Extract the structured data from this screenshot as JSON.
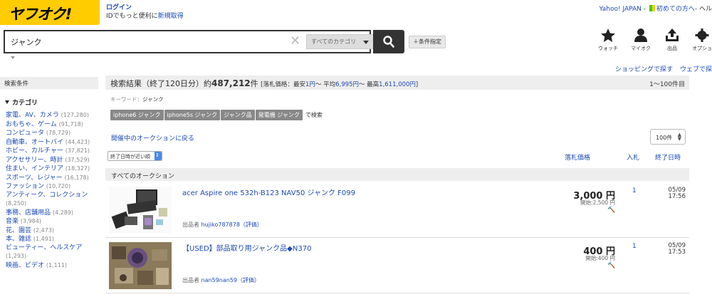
{
  "header": {
    "logo_text": "ヤフオク!",
    "login_label": "ログイン",
    "login_sub_prefix": "IDでもっと便利に",
    "register_link": "新規取得",
    "yahoo_japan": "Yahoo! JAPAN",
    "dash": " - ",
    "first_time": "初めての方へ",
    "help_cut": "- ヘル"
  },
  "search": {
    "query": "ジャンク",
    "category_label": "すべてのカテゴリ",
    "conditions_button": "＋条件指定"
  },
  "toolbar": {
    "watch": "ウォッチ",
    "myauc": "マイオク",
    "sell": "出品",
    "options": "オプショ"
  },
  "sublinks": {
    "shopping": "ショッピングで探す",
    "web": "ウェブで探"
  },
  "sidebar": {
    "heading": "検索条件",
    "category_heading": "カテゴリ",
    "items": [
      {
        "label": "家電、AV、カメラ",
        "count": "(127,280)"
      },
      {
        "label": "おもちゃ、ゲーム",
        "count": "(91,718)"
      },
      {
        "label": "コンピュータ",
        "count": "(78,729)"
      },
      {
        "label": "自動車、オートバイ",
        "count": "(44,423)"
      },
      {
        "label": "ホビー、カルチャー",
        "count": "(37,821)"
      },
      {
        "label": "アクセサリー、時計",
        "count": "(37,529)"
      },
      {
        "label": "住まい、インテリア",
        "count": "(18,327)"
      },
      {
        "label": "スポーツ、レジャー",
        "count": "(16,178)"
      },
      {
        "label": "ファッション",
        "count": "(10,720)"
      },
      {
        "label": "アンティーク、コレクション",
        "count": "(8,250)"
      },
      {
        "label": "事務、店舗用品",
        "count": "(4,289)"
      },
      {
        "label": "音楽",
        "count": "(3,984)"
      },
      {
        "label": "花、園芸",
        "count": "(2,473)"
      },
      {
        "label": "本、雑誌",
        "count": "(1,491)"
      },
      {
        "label": "ビューティー、ヘルスケア",
        "count": "(1,293)"
      },
      {
        "label": "映画、ビデオ",
        "count": "(1,111)"
      }
    ]
  },
  "results": {
    "heading_prefix": "検索結果（終了120日分）約",
    "total": "487,212",
    "heading_suffix": "件",
    "price_info_prefix": "[落札価格：最安",
    "min_price": "1円",
    "avg_label": "〜 平均",
    "avg_price": "6,995円",
    "max_label": "〜 最高",
    "max_price": "1,611,000円",
    "price_info_suffix": "]",
    "range": "1〜100件目",
    "keyword_label": "キーワード：",
    "keyword": "ジャンク",
    "tags": [
      "iphone6 ジャンク",
      "iphone5s ジャンク",
      "ジャンク品",
      "発電機 ジャンク"
    ],
    "tags_suffix": "で検索",
    "back_link": "開催中のオークションに戻る",
    "per_page": "100件",
    "sort_label": "終了日時が近い順",
    "col_price": "落札価格",
    "col_bids": "入札",
    "col_end": "終了日時",
    "section_label": "すべてのオークション",
    "seller_label": "出品者",
    "rating_label": "（評価）"
  },
  "items": [
    {
      "title": "acer Aspire one 532h-B123 NAV50 ジャンク F099",
      "seller": "hujiko787878",
      "price": "3,000 円",
      "start": "開始:2,500 円",
      "bids": "1",
      "end_date": "05/09",
      "end_time": "17:56"
    },
    {
      "title": "【USED】部品取り用ジャンク品◆N370",
      "seller": "nan59nan59",
      "price": "400 円",
      "start": "開始:400 円",
      "bids": "1",
      "end_date": "05/09",
      "end_time": "17:53"
    }
  ]
}
